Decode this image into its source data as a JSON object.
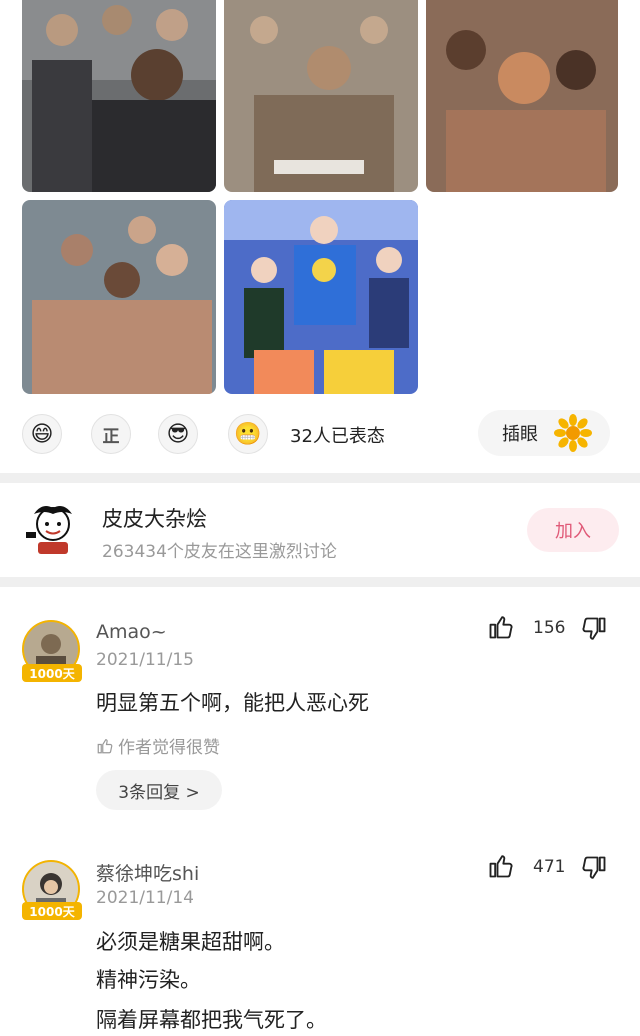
{
  "reactions": {
    "emojis": [
      {
        "name": "laughing-emoji",
        "glyph": "😄"
      },
      {
        "name": "zheng-emoji",
        "glyph": "正"
      },
      {
        "name": "cool-emoji",
        "glyph": "😎"
      },
      {
        "name": "grimace-emoji",
        "glyph": "😬"
      }
    ],
    "count_text": "32人已表态",
    "chayan_label": "插眼"
  },
  "group": {
    "name": "皮皮大杂烩",
    "subtitle": "263434个皮友在这里激烈讨论",
    "join_label": "加入"
  },
  "comments": [
    {
      "username": "Amao~",
      "date": "2021/11/15",
      "badge": "1000天",
      "text": [
        "明显第五个啊，能把人恶心死"
      ],
      "likes": "156",
      "author_liked": "作者觉得很赞",
      "replies_label": "3条回复 >"
    },
    {
      "username": "蔡徐坤吃shi",
      "date": "2021/11/14",
      "badge": "1000天",
      "text": [
        "必须是糖果超甜啊。",
        "精神污染。",
        "隔着屏幕都把我气死了。"
      ],
      "likes": "471"
    }
  ],
  "colors": {
    "accent_pink": "#e05a78",
    "join_bg": "#fdecef",
    "badge_gold": "#f4b400",
    "divider": "#efefef"
  }
}
